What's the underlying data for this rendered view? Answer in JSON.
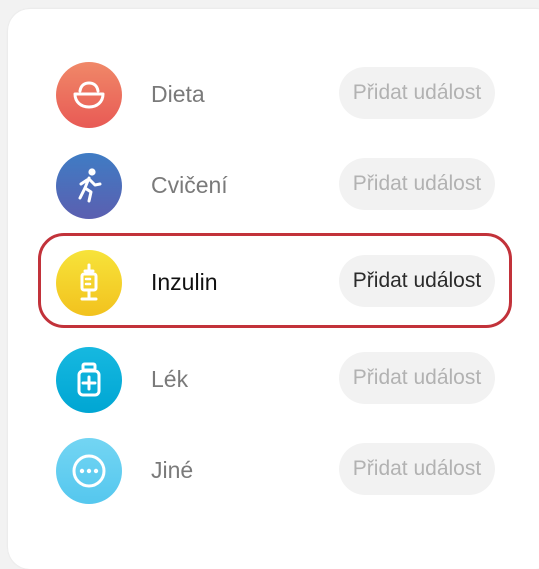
{
  "events": {
    "items": [
      {
        "label": "Dieta",
        "button": "Přidat událost",
        "icon": "bowl-icon",
        "color_from": "#f08868",
        "color_to": "#e85a55"
      },
      {
        "label": "Cvičení",
        "button": "Přidat událost",
        "icon": "running-person-icon",
        "color_from": "#3f7cc4",
        "color_to": "#5b5fb0"
      },
      {
        "label": "Inzulin",
        "button": "Přidat událost",
        "icon": "syringe-icon",
        "color_from": "#f7e33a",
        "color_to": "#f2c21e"
      },
      {
        "label": "Lék",
        "button": "Přidat událost",
        "icon": "medicine-bottle-icon",
        "color_from": "#16b8e0",
        "color_to": "#00a6d3"
      },
      {
        "label": "Jiné",
        "button": "Přidat událost",
        "icon": "more-dots-icon",
        "color_from": "#73d5f3",
        "color_to": "#55c7ee"
      }
    ],
    "highlight_color": "#c2323a"
  }
}
